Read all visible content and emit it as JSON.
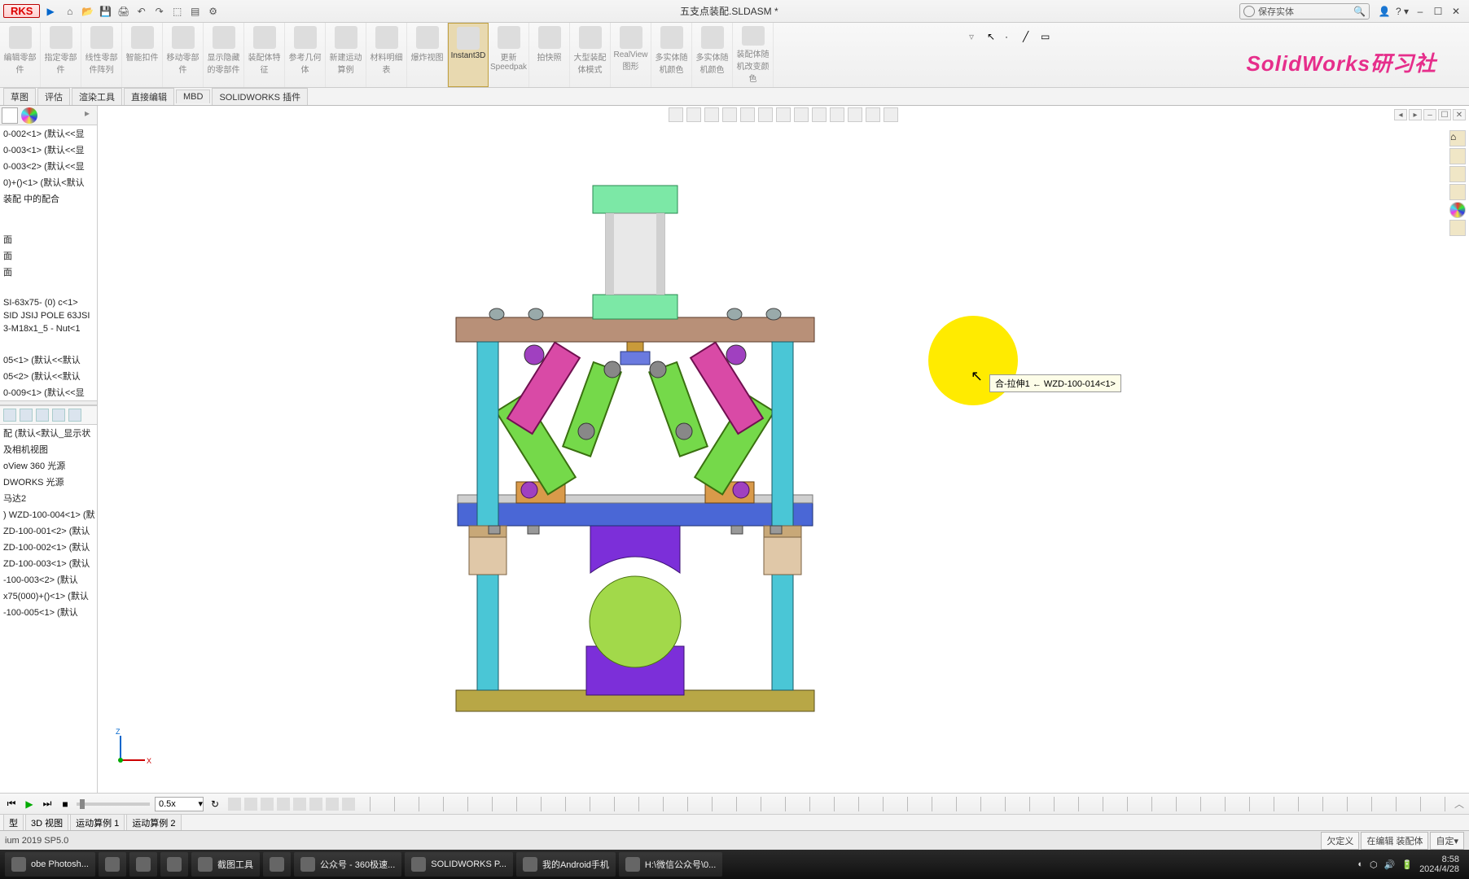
{
  "title": "五支点装配.SLDASM *",
  "app_logo": "RKS",
  "search_placeholder": "保存实体",
  "brand_watermark": "SolidWorks研习社",
  "ribbon_buttons": [
    {
      "label": "编辑零部件"
    },
    {
      "label": "指定零部件"
    },
    {
      "label": "线性零部件阵列"
    },
    {
      "label": "智能扣件"
    },
    {
      "label": "移动零部件"
    },
    {
      "label": "显示隐藏的零部件"
    },
    {
      "label": "装配体特征"
    },
    {
      "label": "参考几何体"
    },
    {
      "label": "新建运动算例"
    },
    {
      "label": "材料明细表"
    },
    {
      "label": "爆炸视图"
    },
    {
      "label": "Instant3D"
    },
    {
      "label": "更新\nSpeedpak"
    },
    {
      "label": "拍快照"
    },
    {
      "label": "大型装配体模式"
    },
    {
      "label": "RealView 图形"
    },
    {
      "label": "多实体随机颜色"
    },
    {
      "label": "多实体随机颜色"
    },
    {
      "label": "装配体随机改变颜色"
    }
  ],
  "active_ribbon_index": 11,
  "tabs": [
    "草图",
    "评估",
    "渲染工具",
    "直接编辑",
    "MBD",
    "SOLIDWORKS 插件"
  ],
  "tree_top": [
    "0-002<1> (默认<<显",
    "0-003<1> (默认<<显",
    "0-003<2> (默认<<显",
    "0)+()<1> (默认<默认",
    "装配 中的配合"
  ],
  "tree_mid": [
    "面",
    "面",
    "面"
  ],
  "tree_mid2": [
    "SI-63x75- (0) c<1>",
    "SID JSIJ POLE 63JSI",
    "3-M18x1_5 - Nut<1"
  ],
  "tree_mid3": [
    "05<1> (默认<<默认",
    "05<2> (默认<<默认",
    "0-009<1> (默认<<显"
  ],
  "tree_bottom": [
    "配 (默认<默认_显示状",
    "及相机视图",
    "oView 360 光源",
    "DWORKS 光源",
    "马达2",
    ") WZD-100-004<1> (默",
    "ZD-100-001<2> (默认",
    "ZD-100-002<1> (默认",
    "ZD-100-003<1> (默认",
    "-100-003<2> (默认",
    "x75(000)+()<1> (默认",
    "-100-005<1> (默认"
  ],
  "tooltip": "合-拉伸1 ← WZD-100-014<1>",
  "speed": "0.5x",
  "motion_tabs": [
    "型",
    "3D 视图",
    "运动算例 1",
    "运动算例 2"
  ],
  "status_left": "ium 2019 SP5.0",
  "status_right": [
    "欠定义",
    "在编辑 装配体",
    "自定▾"
  ],
  "taskbar_items": [
    {
      "label": "obe Photosh..."
    },
    {
      "label": ""
    },
    {
      "label": ""
    },
    {
      "label": ""
    },
    {
      "label": "截图工具"
    },
    {
      "label": ""
    },
    {
      "label": "公众号 - 360极速..."
    },
    {
      "label": "SOLIDWORKS P..."
    },
    {
      "label": "我的Android手机"
    },
    {
      "label": "H:\\微信公众号\\0..."
    }
  ],
  "clock_time": "8:58",
  "clock_date": "2024/4/28",
  "chart_data": {
    "type": "table",
    "note": "CAD assembly view; no chart"
  }
}
